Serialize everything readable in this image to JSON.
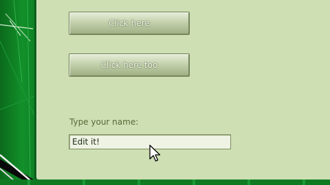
{
  "buttons": {
    "click_here": "Click here",
    "click_here_too": "Click here too"
  },
  "name_prompt": {
    "label": "Type your name:",
    "value": "Edit it!"
  },
  "colors": {
    "panel_bg": "#cddfb3",
    "backdrop_green": "#0f7a22",
    "label_text": "#556a37"
  },
  "icons": {
    "pointer": "mouse-pointer-icon"
  }
}
